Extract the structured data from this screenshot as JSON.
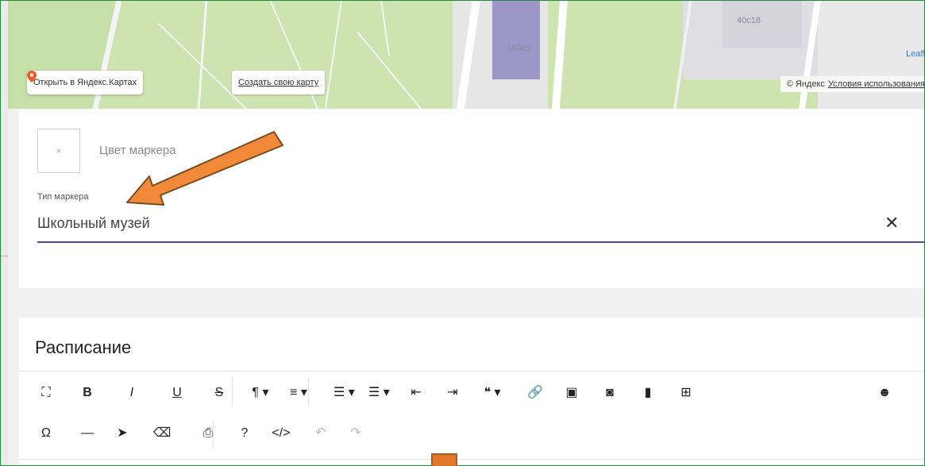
{
  "map": {
    "labels": [
      "38Ас1",
      "40с18"
    ],
    "leaflet": "Leafl",
    "open_in_yandex": "Открыть в Яндекс.Картах",
    "create_map": "Создать свою карту",
    "copyright": "© Яндекс",
    "terms": "Условия использования"
  },
  "marker": {
    "swatch_symbol": "×",
    "color_label": "Цвет маркера",
    "type_label": "Тип маркера",
    "type_value": "Школьный музей",
    "clear_symbol": "✕"
  },
  "schedule": {
    "title": "Расписание",
    "toolbar_row1": [
      {
        "name": "fullscreen-icon",
        "glyph": "⛶"
      },
      {
        "name": "bold-button",
        "glyph": "B"
      },
      {
        "name": "italic-button",
        "glyph": "I"
      },
      {
        "name": "underline-button",
        "glyph": "U"
      },
      {
        "name": "strikethrough-button",
        "glyph": "S"
      },
      {
        "name": "paragraph-format-button",
        "glyph": "¶ ▾"
      },
      {
        "name": "align-button",
        "glyph": "≡ ▾"
      },
      {
        "name": "ordered-list-button",
        "glyph": "☰ ▾"
      },
      {
        "name": "unordered-list-button",
        "glyph": "☰ ▾"
      },
      {
        "name": "outdent-button",
        "glyph": "⇤"
      },
      {
        "name": "indent-button",
        "glyph": "⇥"
      },
      {
        "name": "quote-button",
        "glyph": "❝ ▾"
      },
      {
        "name": "link-icon",
        "glyph": "🔗"
      },
      {
        "name": "image-icon",
        "glyph": "▣"
      },
      {
        "name": "camera-icon",
        "glyph": "◙"
      },
      {
        "name": "file-icon",
        "glyph": "▮"
      },
      {
        "name": "table-icon",
        "glyph": "⊞"
      },
      {
        "name": "emoji-icon",
        "glyph": "☻"
      }
    ],
    "toolbar_row2": [
      {
        "name": "special-chars-icon",
        "glyph": "Ω"
      },
      {
        "name": "horizontal-line-icon",
        "glyph": "—"
      },
      {
        "name": "select-all-icon",
        "glyph": "➤"
      },
      {
        "name": "clear-format-icon",
        "glyph": "⌫"
      },
      {
        "name": "print-icon",
        "glyph": "⎙"
      },
      {
        "name": "help-icon",
        "glyph": "?"
      },
      {
        "name": "code-view-icon",
        "glyph": "</>"
      },
      {
        "name": "undo-icon",
        "glyph": "↶"
      },
      {
        "name": "redo-icon",
        "glyph": "↷"
      }
    ]
  },
  "colors": {
    "accent_arrow": "#f08a3a",
    "underline": "#4e4a7a",
    "frame": "#1f8a3b"
  }
}
